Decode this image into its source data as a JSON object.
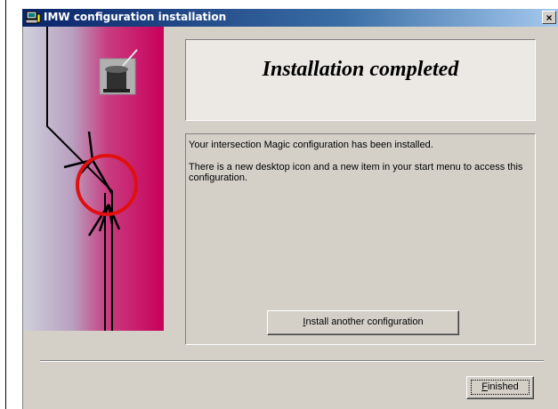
{
  "window": {
    "title": "IMW configuration installation",
    "title_icon": "setup-computer-icon",
    "close_label": "×"
  },
  "side_art": {
    "icon": "magic-top-hat-icon",
    "colors": {
      "gradient_left": "#c8c8d8",
      "gradient_right": "#c8005a",
      "ring": "#e01010"
    }
  },
  "main": {
    "heading": "Installation completed",
    "message_line_1": "Your intersection Magic configuration has been installed.",
    "message_line_2": "There is a new desktop icon and a new item in your start menu to access this configuration.",
    "install_another_button": {
      "prefix": "",
      "accel": "I",
      "rest": "nstall another configuration"
    }
  },
  "footer": {
    "finished_button": {
      "prefix": "",
      "accel": "F",
      "rest": "inished"
    }
  },
  "colors": {
    "face": "#d4d0c8",
    "titlebar": "#0a246a"
  }
}
